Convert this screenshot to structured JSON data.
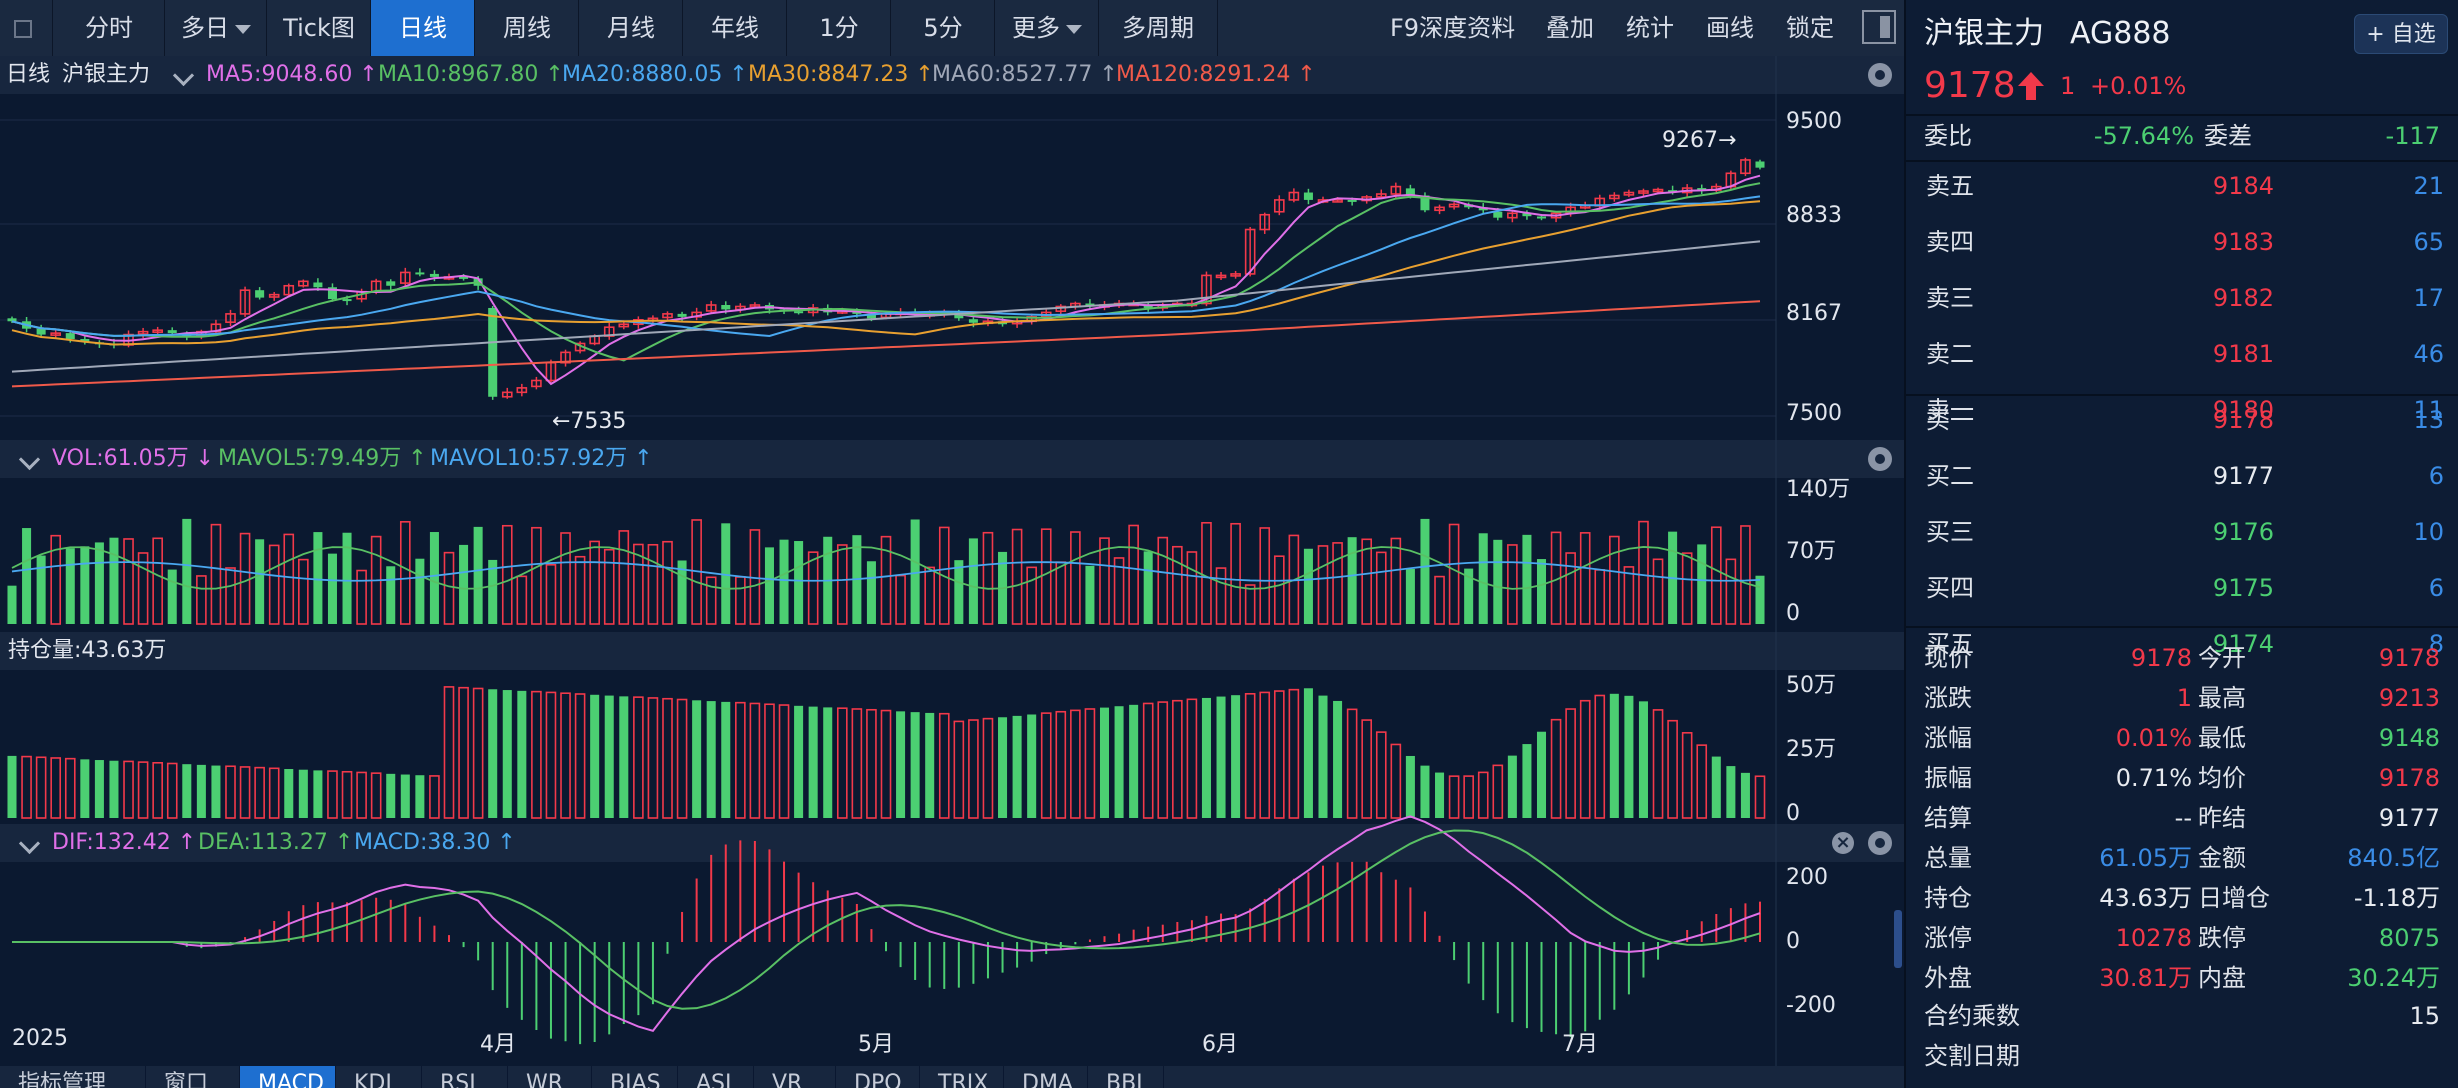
{
  "toolbar": {
    "tabs": [
      "分时",
      "多日",
      "Tick图",
      "日线",
      "周线",
      "月线",
      "年线",
      "1分",
      "5分",
      "更多",
      "多周期"
    ],
    "active_tab": "日线",
    "right": [
      "F9深度资料",
      "叠加",
      "统计",
      "画线",
      "锁定"
    ]
  },
  "ma_bar": {
    "label": "日线",
    "name": "沪银主力",
    "items": [
      {
        "text": "MA5:9048.60 ↑",
        "color": "#e070e8"
      },
      {
        "text": "MA10:8967.80 ↑",
        "color": "#59c064"
      },
      {
        "text": "MA20:8880.05 ↑",
        "color": "#4aa8f0"
      },
      {
        "text": "MA30:8847.23 ↑",
        "color": "#e8a030"
      },
      {
        "text": "MA60:8527.77 ↑",
        "color": "#a0a8b8"
      },
      {
        "text": "MA120:8291.24 ↑",
        "color": "#f05a4a"
      }
    ]
  },
  "vol_bar": {
    "items": [
      {
        "text": "VOL:61.05万 ↓",
        "color": "#e070e8"
      },
      {
        "text": "MAVOL5:79.49万 ↑",
        "color": "#59c064"
      },
      {
        "text": "MAVOL10:57.92万 ↑",
        "color": "#4aa8f0"
      }
    ]
  },
  "oi_bar": {
    "label": "持仓量:43.63万"
  },
  "macd_bar": {
    "items": [
      {
        "text": "DIF:132.42 ↑",
        "color": "#e070e8"
      },
      {
        "text": "DEA:113.27 ↑",
        "color": "#59c064"
      },
      {
        "text": "MACD:38.30 ↑",
        "color": "#4aa8f0"
      }
    ]
  },
  "bottom_tabs": [
    "指标管理",
    "窗口",
    "MACD",
    "KDJ",
    "RSI",
    "WR",
    "BIAS",
    "ASI",
    "VR",
    "DPO",
    "TRIX",
    "DMA",
    "BBI"
  ],
  "active_bottom_tab": "MACD",
  "colors": {
    "up": "#f2394a",
    "down": "#4ccf72",
    "ma5": "#e070e8",
    "ma10": "#59c064",
    "ma20": "#4aa8f0",
    "ma30": "#e8a030",
    "ma60": "#a0a8b8",
    "ma120": "#f05a4a"
  },
  "panel": {
    "title": "沪银主力",
    "code": "AG888",
    "add_label": "+ 自选",
    "last": "9178",
    "change": "1",
    "change_pct": "+0.01%",
    "webi_label": "委比",
    "webi": "-57.64%",
    "wecha_label": "委差",
    "wecha": "-117",
    "asks": [
      {
        "label": "卖五",
        "price": "9184",
        "vol": "21"
      },
      {
        "label": "卖四",
        "price": "9183",
        "vol": "65"
      },
      {
        "label": "卖三",
        "price": "9182",
        "vol": "17"
      },
      {
        "label": "卖二",
        "price": "9181",
        "vol": "46"
      },
      {
        "label": "卖一",
        "price": "9180",
        "vol": "11"
      }
    ],
    "bids": [
      {
        "label": "买一",
        "price": "9178",
        "vol": "13",
        "color": "#f2394a"
      },
      {
        "label": "买二",
        "price": "9177",
        "vol": "6",
        "color": "#e8ebf0"
      },
      {
        "label": "买三",
        "price": "9176",
        "vol": "10",
        "color": "#4ccf72"
      },
      {
        "label": "买四",
        "price": "9175",
        "vol": "6",
        "color": "#4ccf72"
      },
      {
        "label": "买五",
        "price": "9174",
        "vol": "8",
        "color": "#4ccf72"
      }
    ],
    "stats": [
      {
        "l1": "现价",
        "v1": "9178",
        "c1": "#f2394a",
        "l2": "今开",
        "v2": "9178",
        "c2": "#f2394a"
      },
      {
        "l1": "涨跌",
        "v1": "1",
        "c1": "#f2394a",
        "l2": "最高",
        "v2": "9213",
        "c2": "#f2394a"
      },
      {
        "l1": "涨幅",
        "v1": "0.01%",
        "c1": "#f2394a",
        "l2": "最低",
        "v2": "9148",
        "c2": "#4ccf72"
      },
      {
        "l1": "振幅",
        "v1": "0.71%",
        "c1": "#e8ebf0",
        "l2": "均价",
        "v2": "9178",
        "c2": "#f2394a"
      },
      {
        "l1": "结算",
        "v1": "--",
        "c1": "#e8ebf0",
        "l2": "昨结",
        "v2": "9177",
        "c2": "#e8ebf0"
      },
      {
        "l1": "总量",
        "v1": "61.05万",
        "c1": "#3a8ce6",
        "l2": "金额",
        "v2": "840.5亿",
        "c2": "#3a8ce6"
      },
      {
        "l1": "持仓",
        "v1": "43.63万",
        "c1": "#e8ebf0",
        "l2": "日增仓",
        "v2": "-1.18万",
        "c2": "#e8ebf0"
      },
      {
        "l1": "涨停",
        "v1": "10278",
        "c1": "#f2394a",
        "l2": "跌停",
        "v2": "8075",
        "c2": "#4ccf72"
      },
      {
        "l1": "外盘",
        "v1": "30.81万",
        "c1": "#f2394a",
        "l2": "内盘",
        "v2": "30.24万",
        "c2": "#4ccf72"
      }
    ],
    "contract_label": "合约乘数",
    "contract_value": "15",
    "delivery_label": "交割日期"
  },
  "chart_data": {
    "type": "candlestick",
    "price_axis": {
      "ticks": [
        9500,
        8833,
        8167,
        7500
      ],
      "ylim": [
        7500,
        9500
      ]
    },
    "annotations": {
      "high": "9267→",
      "low": "←7535"
    },
    "x_labels": [
      "2025",
      "4月",
      "5月",
      "6月",
      "7月"
    ],
    "vol_axis": [
      "140万",
      "70万",
      "0"
    ],
    "oi_axis": [
      "50万",
      "25万",
      "0"
    ],
    "macd_axis": [
      "200",
      "0",
      "-200"
    ],
    "close": [
      8140,
      8090,
      8050,
      8060,
      8020,
      8000,
      7990,
      7980,
      8050,
      8070,
      8080,
      8060,
      8040,
      8070,
      8120,
      8190,
      8350,
      8300,
      8320,
      8380,
      8410,
      8370,
      8290,
      8280,
      8340,
      8410,
      8380,
      8470,
      8460,
      8440,
      8440,
      8430,
      8380,
      7630,
      7660,
      7690,
      7740,
      7860,
      7930,
      7990,
      8040,
      8100,
      8120,
      8150,
      8160,
      8190,
      8170,
      8200,
      8250,
      8220,
      8240,
      8250,
      8220,
      8210,
      8200,
      8230,
      8200,
      8210,
      8190,
      8160,
      8190,
      8200,
      8190,
      8190,
      8200,
      8160,
      8130,
      8140,
      8120,
      8140,
      8170,
      8200,
      8240,
      8260,
      8240,
      8250,
      8260,
      8260,
      8230,
      8250,
      8260,
      8260,
      8450,
      8450,
      8460,
      8760,
      8860,
      8960,
      9010,
      8960,
      8960,
      8960,
      8950,
      8980,
      9000,
      9050,
      8990,
      8890,
      8910,
      8930,
      8910,
      8890,
      8840,
      8870,
      8850,
      8840,
      8870,
      8910,
      8920,
      8970,
      8990,
      9010,
      9020,
      9030,
      9010,
      9040,
      9020,
      9050,
      9140,
      9230,
      9178
    ]
  }
}
